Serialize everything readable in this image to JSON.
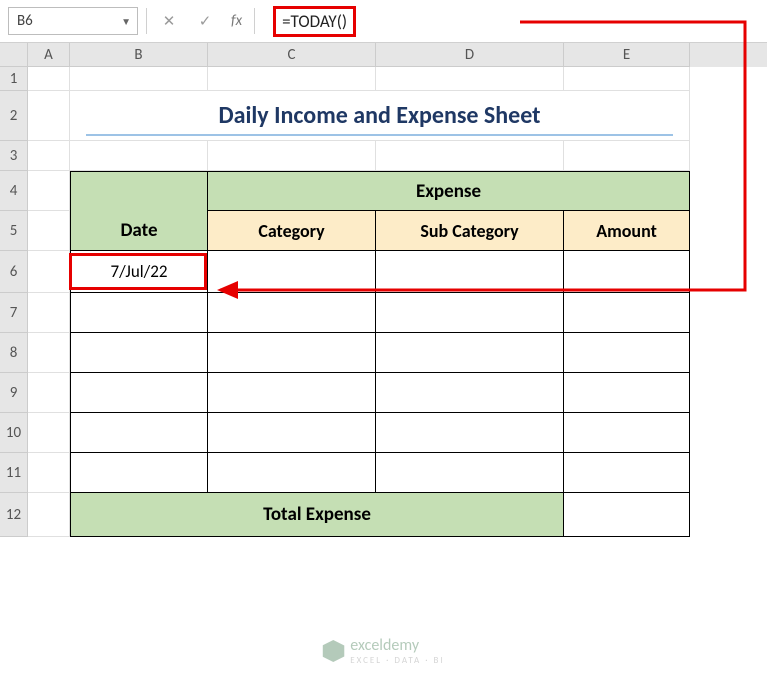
{
  "name_box": "B6",
  "fx_label": "fx",
  "formula": "=TODAY()",
  "columns": {
    "A": "A",
    "B": "B",
    "C": "C",
    "D": "D",
    "E": "E"
  },
  "row_numbers": [
    "1",
    "2",
    "3",
    "4",
    "5",
    "6",
    "7",
    "8",
    "9",
    "10",
    "11",
    "12"
  ],
  "title": "Daily Income and Expense Sheet",
  "headers": {
    "date": "Date",
    "expense": "Expense",
    "category": "Category",
    "sub_category": "Sub Category",
    "amount": "Amount"
  },
  "data": {
    "b6": "7/Jul/22",
    "total_expense": "Total Expense"
  },
  "watermark": {
    "brand": "exceldemy",
    "tagline": "EXCEL · DATA · BI"
  },
  "chart_data": {
    "type": "table",
    "title": "Daily Income and Expense Sheet",
    "columns": [
      "Date",
      "Category",
      "Sub Category",
      "Amount"
    ],
    "rows": [
      [
        "7/Jul/22",
        "",
        "",
        ""
      ],
      [
        "",
        "",
        "",
        ""
      ],
      [
        "",
        "",
        "",
        ""
      ],
      [
        "",
        "",
        "",
        ""
      ],
      [
        "",
        "",
        "",
        ""
      ],
      [
        "",
        "",
        "",
        ""
      ]
    ],
    "footer": [
      "Total Expense",
      "",
      "",
      ""
    ]
  }
}
